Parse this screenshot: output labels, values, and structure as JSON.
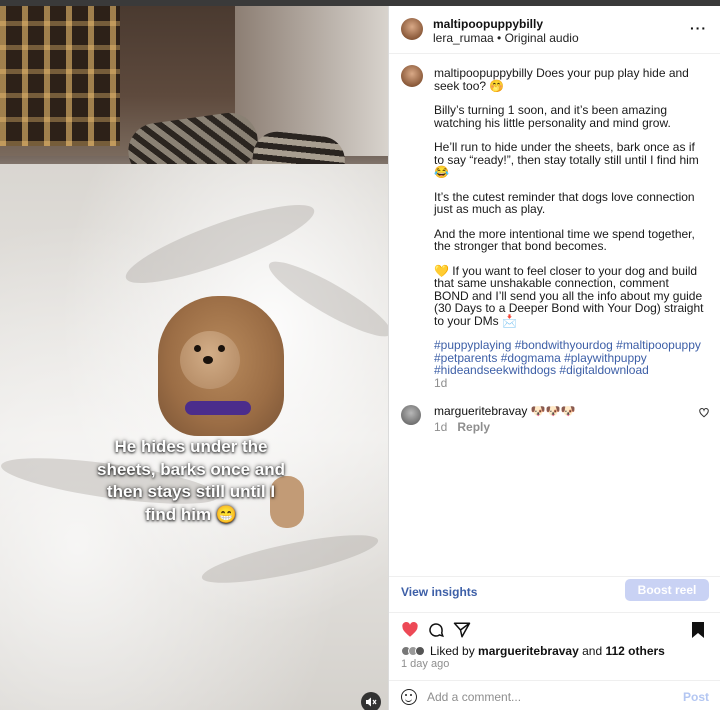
{
  "media": {
    "overlay_caption": "He hides under the sheets, barks once and then stays still until I find him 😁",
    "mute_icon": "speaker-muted-icon"
  },
  "header": {
    "username": "maltipoopuppybilly",
    "audio": "lera_rumaa • Original audio",
    "more_icon": "more-options-icon",
    "more_glyph": "···"
  },
  "caption": {
    "username": "maltipoopuppybilly",
    "paragraphs": [
      "Does your pup play hide and seek too? 🤭",
      "Billy’s turning 1 soon, and it’s been amazing watching his little personality and mind grow.",
      "He’ll run to hide under the sheets, bark once as if to say “ready!”, then stay totally still until I find him 😂",
      "It’s the cutest reminder that dogs love connection just as much as play.",
      "And the more intentional time we spend together, the stronger that bond becomes.",
      "💛 If you want to feel closer to your dog and build that same unshakable connection, comment BOND and I’ll send you all the info about my guide (30 Days to a Deeper Bond with Your Dog) straight to your DMs 📩"
    ],
    "hashtags": "#puppyplaying #bondwithyourdog #maltipoopuppy #petparents #dogmama #playwithpuppy #hideandseekwithdogs #digitaldownload",
    "time": "1d"
  },
  "comment": {
    "username": "margueritebravay",
    "text": "🐶🐶🐶",
    "time": "1d",
    "reply_label": "Reply"
  },
  "insights": {
    "view_label": "View insights",
    "boost_label": "Boost reel"
  },
  "actions": {
    "liked_prefix": "Liked by",
    "liked_user": "margueritebravay",
    "liked_and": "and",
    "liked_others": "112 others",
    "ago": "1 day ago"
  },
  "add_comment": {
    "placeholder": "Add a comment...",
    "post_label": "Post"
  },
  "colors": {
    "link": "#3d5fa7",
    "heart": "#ed4956",
    "boost_bg": "#c9d2f4",
    "post_disabled": "#b3c6f2"
  }
}
